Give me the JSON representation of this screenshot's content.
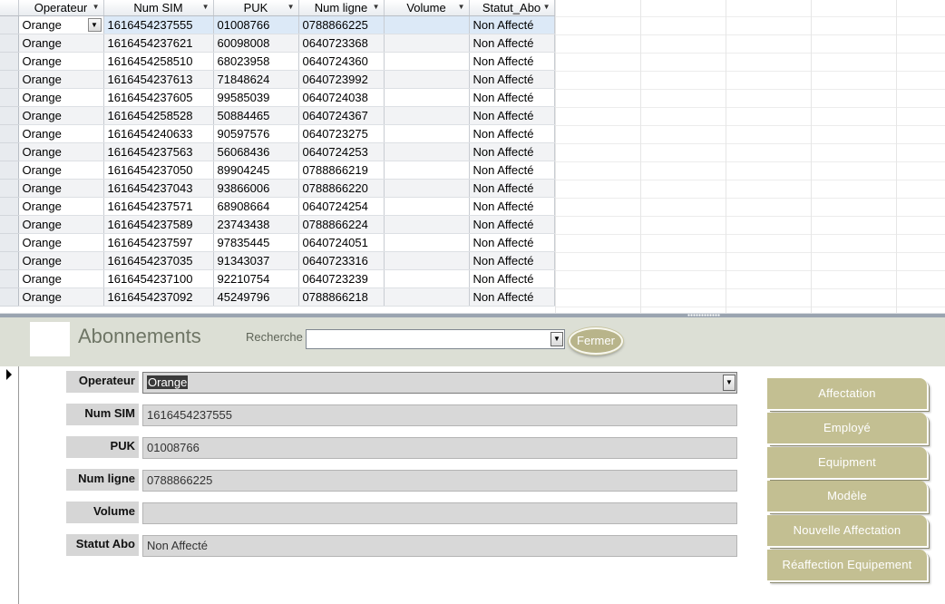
{
  "datasheet": {
    "columns": [
      {
        "label": "Operateur",
        "width": 94
      },
      {
        "label": "Num SIM",
        "width": 121
      },
      {
        "label": "PUK",
        "width": 94
      },
      {
        "label": "Num ligne",
        "width": 94
      },
      {
        "label": "Volume",
        "width": 94
      },
      {
        "label": "Statut_Abo",
        "width": 94
      }
    ],
    "rows": [
      [
        "Orange",
        "1616454237555",
        "01008766",
        "0788866225",
        "",
        "Non Affecté"
      ],
      [
        "Orange",
        "1616454237621",
        "60098008",
        "0640723368",
        "",
        "Non Affecté"
      ],
      [
        "Orange",
        "1616454258510",
        "68023958",
        "0640724360",
        "",
        "Non Affecté"
      ],
      [
        "Orange",
        "1616454237613",
        "71848624",
        "0640723992",
        "",
        "Non Affecté"
      ],
      [
        "Orange",
        "1616454237605",
        "99585039",
        "0640724038",
        "",
        "Non Affecté"
      ],
      [
        "Orange",
        "1616454258528",
        "50884465",
        "0640724367",
        "",
        "Non Affecté"
      ],
      [
        "Orange",
        "1616454240633",
        "90597576",
        "0640723275",
        "",
        "Non Affecté"
      ],
      [
        "Orange",
        "1616454237563",
        "56068436",
        "0640724253",
        "",
        "Non Affecté"
      ],
      [
        "Orange",
        "1616454237050",
        "89904245",
        "0788866219",
        "",
        "Non Affecté"
      ],
      [
        "Orange",
        "1616454237043",
        "93866006",
        "0788866220",
        "",
        "Non Affecté"
      ],
      [
        "Orange",
        "1616454237571",
        "68908664",
        "0640724254",
        "",
        "Non Affecté"
      ],
      [
        "Orange",
        "1616454237589",
        "23743438",
        "0788866224",
        "",
        "Non Affecté"
      ],
      [
        "Orange",
        "1616454237597",
        "97835445",
        "0640724051",
        "",
        "Non Affecté"
      ],
      [
        "Orange",
        "1616454237035",
        "91343037",
        "0640723316",
        "",
        "Non Affecté"
      ],
      [
        "Orange",
        "1616454237100",
        "92210754",
        "0640723239",
        "",
        "Non Affecté"
      ],
      [
        "Orange",
        "1616454237092",
        "45249796",
        "0788866218",
        "",
        "Non Affecté"
      ]
    ]
  },
  "header": {
    "title": "Abonnements",
    "search_label": "Recherche",
    "search_value": "",
    "close_label": "Fermer"
  },
  "form": {
    "fields": [
      {
        "label": "Operateur",
        "value": "Orange"
      },
      {
        "label": "Num SIM",
        "value": "1616454237555"
      },
      {
        "label": "PUK",
        "value": "01008766"
      },
      {
        "label": "Num ligne",
        "value": "0788866225"
      },
      {
        "label": "Volume",
        "value": ""
      },
      {
        "label": "Statut Abo",
        "value": "Non Affecté"
      }
    ]
  },
  "nav_buttons": [
    "Affectation",
    "Employé",
    "Equipment",
    "Modèle",
    "Nouvelle Affectation",
    "Réaffection Equipement"
  ],
  "colors": {
    "button_bg": "#c3bf92",
    "header_bg": "#dcdfd5",
    "current_row": "#dce9f7"
  }
}
